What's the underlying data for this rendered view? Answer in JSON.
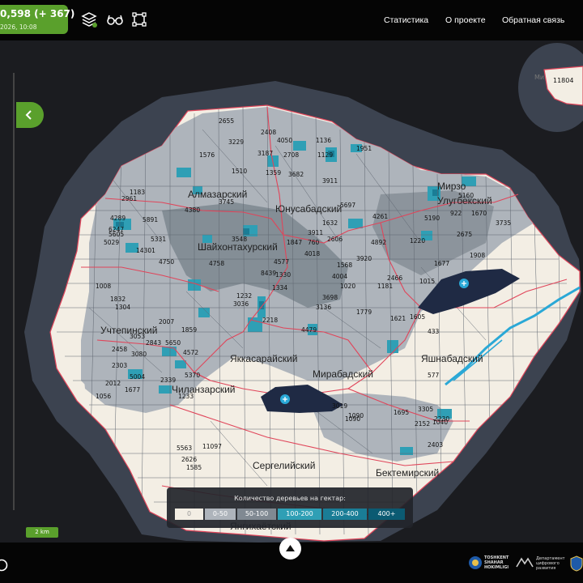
{
  "header": {
    "counter_value": "0,598 (+ 367)",
    "counter_date": "2026, 10:08",
    "nav": [
      "Статистика",
      "О проекте",
      "Обратная связь"
    ]
  },
  "tools": [
    {
      "name": "layers-icon"
    },
    {
      "name": "glasses-icon"
    },
    {
      "name": "frame-icon"
    }
  ],
  "map": {
    "districts": [
      {
        "id": "almazar",
        "label": "Алмазарский"
      },
      {
        "id": "yunusabad",
        "label": "Юнусабадский"
      },
      {
        "id": "mirzo1",
        "label": "Мирзо"
      },
      {
        "id": "mirzo2",
        "label": "Улугбекский"
      },
      {
        "id": "shayhon",
        "label": "Шайхонтахурский"
      },
      {
        "id": "uchtepa",
        "label": "Учтепинский"
      },
      {
        "id": "yakkasaray",
        "label": "Яккасарайский"
      },
      {
        "id": "yashnabad",
        "label": "Яшнабадский"
      },
      {
        "id": "mirabad",
        "label": "Мирабадский"
      },
      {
        "id": "chilanzar",
        "label": "Чиланзарский"
      },
      {
        "id": "sergeli",
        "label": "Сергелийский"
      },
      {
        "id": "bektemir",
        "label": "Бектемирский"
      },
      {
        "id": "yangihayot",
        "label": "Янгихаётский"
      }
    ],
    "separate_region_label": "11804",
    "separate_region_prefix": "Ми",
    "numbers": [
      "2655",
      "2408",
      "3229",
      "4050",
      "1136",
      "1576",
      "3187",
      "2708",
      "1129",
      "1951",
      "1510",
      "1359",
      "3682",
      "3911",
      "2961",
      "1183",
      "4380",
      "3745",
      "5891",
      "4289",
      "6247",
      "5029",
      "5605",
      "14301",
      "4750",
      "1008",
      "5331",
      "3548",
      "4758",
      "4577",
      "3911",
      "1847",
      "1632",
      "5697",
      "4261",
      "4892",
      "3920",
      "2466",
      "1220",
      "1677",
      "1015",
      "1908",
      "3735",
      "922",
      "1670",
      "5190",
      "2675",
      "5160",
      "1232",
      "3036",
      "8439",
      "2218",
      "1334",
      "1832",
      "1304",
      "4479",
      "3136",
      "3698",
      "1779",
      "1090",
      "2007",
      "1859",
      "5650",
      "4572",
      "2458",
      "3053",
      "2843",
      "2303",
      "5004",
      "3080",
      "5370",
      "2339",
      "1677",
      "1056",
      "2012",
      "1233",
      "3019",
      "1090",
      "1695",
      "3305",
      "2152",
      "1040",
      "2230",
      "2403",
      "5563",
      "11097",
      "2626",
      "1585",
      "577",
      "1605",
      "1621",
      "433",
      "1181",
      "1020",
      "4004",
      "1330",
      "760",
      "2606",
      "4018",
      "1568"
    ]
  },
  "legend": {
    "title": "Количество деревьев на гектар:",
    "items": [
      {
        "label": "0",
        "color": "#f3eee4",
        "text": "#999999"
      },
      {
        "label": "0-50",
        "color": "#aeb4bb",
        "text": "#ffffff"
      },
      {
        "label": "50-100",
        "color": "#808992",
        "text": "#ffffff"
      },
      {
        "label": "100-200",
        "color": "#2f9fb5",
        "text": "#ffffff"
      },
      {
        "label": "200-400",
        "color": "#1a7d96",
        "text": "#ffffff"
      },
      {
        "label": "400+",
        "color": "#0b5a72",
        "text": "#ffffff"
      }
    ]
  },
  "scale_label": "2 km",
  "logos": [
    {
      "name": "tashkent-hokimligi-logo",
      "lines": [
        "TOSHKENT",
        "SHAHAR",
        "HOKIMLIGI"
      ]
    },
    {
      "name": "digital-department-logo",
      "lines": [
        "Департамент",
        "цифрового",
        "развития"
      ]
    }
  ],
  "colors": {
    "accent": "#5aa02c",
    "map_bg": "#1b1c20",
    "buffer": "#3c4350",
    "city_base": "#f3eee4",
    "district_border": "#e0455a",
    "water": "#2aa8d6"
  }
}
